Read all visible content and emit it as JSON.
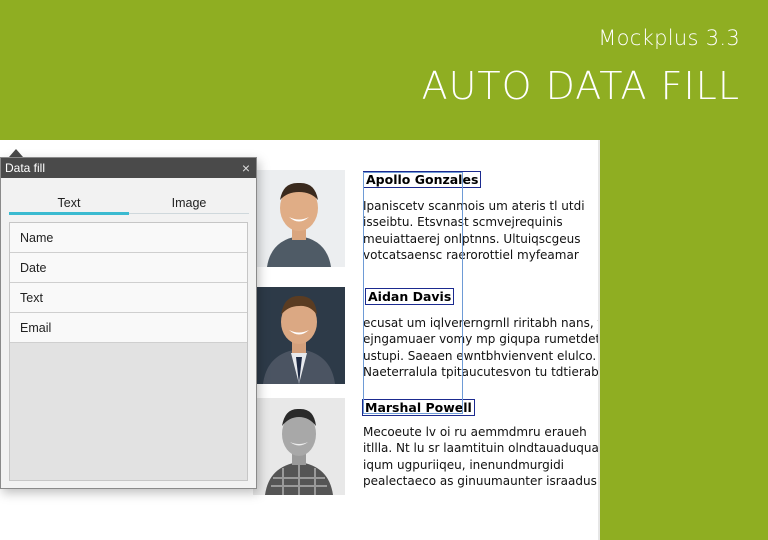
{
  "header": {
    "product": "Mockplus 3.3",
    "headline": "AUTO DATA FILL"
  },
  "profiles": [
    {
      "name": "Apollo Gonzales",
      "lines": [
        "Ipaniscetv scanmois um ateris tl utdi",
        "isseibtu. Etsvnast scmvejrequinis",
        "meuiattaerej onlptnns. Ultuiqscgeus",
        "votcatsaensc raerorottiel myfeamar"
      ]
    },
    {
      "name": "Aidan Davis",
      "lines": [
        "ecusat  um iqlvererngrnll riritabh nans, tc",
        "ejngamuaer vomy mp giqupa rumetdet;",
        "ustupi. Saeaen ewntbhvienvent elulco.",
        "Naeterralula tpitaucutesvon tu tdtierab"
      ]
    },
    {
      "name": "Marshal Powell",
      "lines": [
        "Mecoeute lv oi ru aemmdmru eraueh",
        "itllla. Nt lu  sr laamtituin olndtauaduqua",
        "iqum ugpuriiqeu, inenundmurgidi",
        "pealectaeco  as ginuumaunter israadusit"
      ]
    }
  ],
  "panel": {
    "title": "Data fill",
    "close_glyph": "×",
    "tabs": [
      "Text",
      "Image"
    ],
    "active_tab": "Text",
    "items": [
      "Name",
      "Date",
      "Text",
      "Email"
    ],
    "accent": "#3bbad0"
  },
  "colors": {
    "background": "#8fae22",
    "selection": "#1b2a8f"
  }
}
